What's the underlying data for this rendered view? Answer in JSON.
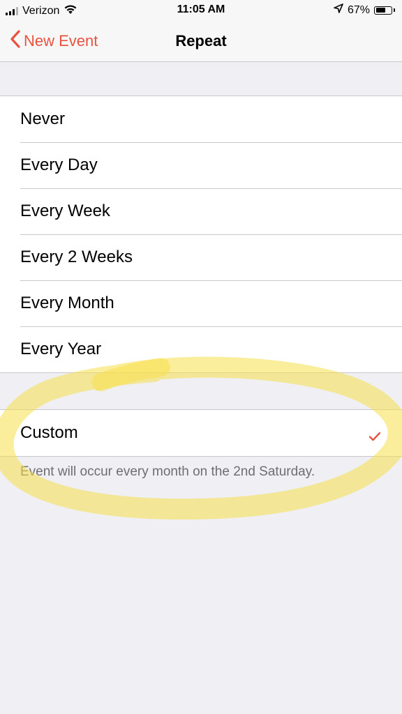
{
  "status_bar": {
    "carrier": "Verizon",
    "time": "11:05 AM",
    "battery_percent": "67%",
    "battery_level": 0.67,
    "icons": [
      "signal-icon",
      "wifi-icon",
      "location-arrow-icon",
      "battery-icon"
    ]
  },
  "nav": {
    "back_label": "New Event",
    "title": "Repeat"
  },
  "repeat_options": [
    {
      "label": "Never"
    },
    {
      "label": "Every Day"
    },
    {
      "label": "Every Week"
    },
    {
      "label": "Every 2 Weeks"
    },
    {
      "label": "Every Month"
    },
    {
      "label": "Every Year"
    }
  ],
  "custom": {
    "label": "Custom",
    "selected": true,
    "description": "Event will occur every month on the 2nd Saturday."
  },
  "colors": {
    "accent": "#e8533f",
    "highlight": "#f5e04a"
  }
}
